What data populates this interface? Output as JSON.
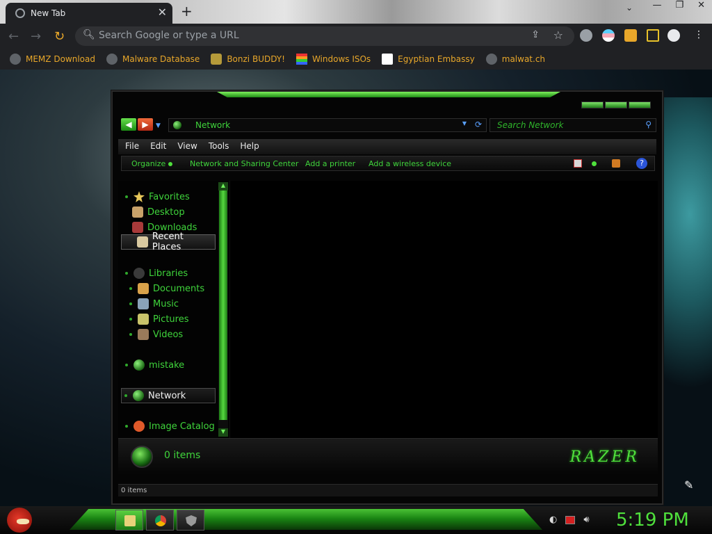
{
  "browser": {
    "tab_title": "New Tab",
    "omnibox_placeholder": "Search Google or type a URL",
    "bookmarks": [
      {
        "label": "MEMZ Download",
        "icon": "globe-icon"
      },
      {
        "label": "Malware Database",
        "icon": "globe-icon"
      },
      {
        "label": "Bonzi BUDDY!",
        "icon": "bonzi-icon"
      },
      {
        "label": "Windows ISOs",
        "icon": "windows-flag-icon"
      },
      {
        "label": "Egyptian Embassy",
        "icon": "wix-icon"
      },
      {
        "label": "malwat.ch",
        "icon": "globe-icon"
      }
    ],
    "accent": "#e8a72a"
  },
  "explorer": {
    "address": "Network",
    "search_placeholder": "Search Network",
    "menu": [
      "File",
      "Edit",
      "View",
      "Tools",
      "Help"
    ],
    "commands": [
      "Organize",
      "Network and Sharing Center",
      "Add a printer",
      "Add a wireless device"
    ],
    "nav": {
      "favorites": "Favorites",
      "desktop": "Desktop",
      "downloads": "Downloads",
      "recent": "Recent Places",
      "libraries": "Libraries",
      "documents": "Documents",
      "music": "Music",
      "pictures": "Pictures",
      "videos": "Videos",
      "homegroup": "mistake",
      "network": "Network",
      "catalog": "Image Catalog"
    },
    "details_count": "0 items",
    "status_count": "0 items",
    "brand": "Razer",
    "accent": "#3fd43b"
  },
  "taskbar": {
    "clock": "5:19 PM"
  }
}
